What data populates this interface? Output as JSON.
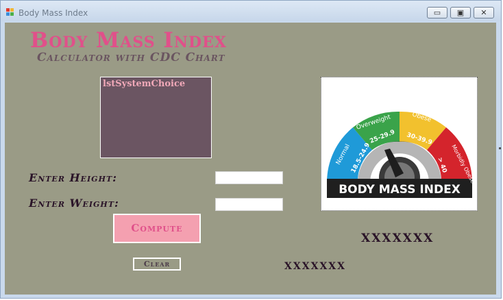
{
  "window": {
    "title": "Body Mass Index",
    "controls": {
      "minimize": "▭",
      "maximize": "▣",
      "close": "✕"
    }
  },
  "header": {
    "title": "Body Mass Index",
    "subtitle": "Calculator with CDC Chart"
  },
  "system_list": {
    "items": [
      "lstSystemChoice"
    ]
  },
  "form": {
    "height_label": "Enter Height:",
    "weight_label": "Enter Weight:",
    "height_value": "",
    "weight_value": "",
    "compute_label": "Compute",
    "clear_label": "Clear"
  },
  "results": {
    "bmi_value": "XXXXXXX",
    "category_value": "XXXXXXX"
  },
  "gauge_image": {
    "segments": [
      {
        "label": "Normal",
        "range": "18.5-24.9",
        "color": "#1f9ad8"
      },
      {
        "label": "Overweight",
        "range": "25-29.9",
        "color": "#3aa34a"
      },
      {
        "label": "Obese",
        "range": "30-39.9",
        "color": "#f2c12e"
      },
      {
        "label": "Morbidly Obese",
        "range": "> 40",
        "color": "#d4242c"
      }
    ],
    "banner": "BODY MASS INDEX"
  },
  "colors": {
    "accent": "#e0508a",
    "panel": "#9a9b86",
    "listbox": "#6b5562",
    "button": "#f4a0b0"
  }
}
